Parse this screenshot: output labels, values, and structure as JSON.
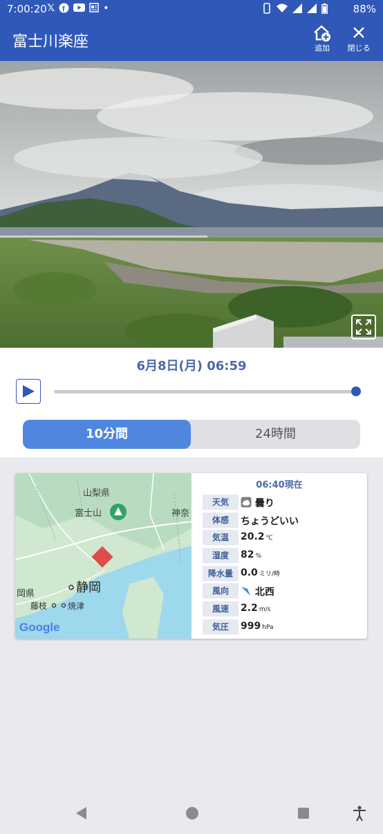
{
  "status_bar": {
    "time": "7:00:20",
    "icons": [
      "x-icon",
      "facebook-icon",
      "youtube-icon",
      "news-icon",
      "dot-icon"
    ],
    "battery": "88%"
  },
  "app_bar": {
    "title": "富士川楽座",
    "add_label": "追加",
    "close_label": "閉じる"
  },
  "camera": {
    "datetime": "6月8日(月) 06:59",
    "timeline_progress": 1.0
  },
  "tabs": [
    {
      "label": "10分間",
      "active": true
    },
    {
      "label": "24時間",
      "active": false
    }
  ],
  "map": {
    "labels": {
      "yamanashi": "山梨県",
      "fujisan": "富士山",
      "kanagawa": "神奈",
      "shizuoka_pref": "岡県",
      "shizuoka_city": "静岡",
      "fujieda": "藤枝",
      "yaizu": "焼津"
    },
    "attribution": "Google"
  },
  "weather": {
    "as_of": "06:40現在",
    "rows": [
      {
        "label": "天気",
        "value": "曇り",
        "unit": "",
        "icon": "cloud-icon"
      },
      {
        "label": "体感",
        "value": "ちょうどいい",
        "unit": ""
      },
      {
        "label": "気温",
        "value": "20.2",
        "unit": "℃"
      },
      {
        "label": "湿度",
        "value": "82",
        "unit": "%"
      },
      {
        "label": "降水量",
        "value": "0.0",
        "unit": "ミリ/時"
      },
      {
        "label": "風向",
        "value": "北西",
        "unit": "",
        "icon": "wind-arrow-icon"
      },
      {
        "label": "風速",
        "value": "2.2",
        "unit": "m/s"
      },
      {
        "label": "気圧",
        "value": "999",
        "unit": "hPa"
      }
    ]
  },
  "colors": {
    "primary": "#2f58b8",
    "tab_active": "#4f86e0",
    "label_bg": "#e5e9f0",
    "marker": "#e04c4c"
  }
}
